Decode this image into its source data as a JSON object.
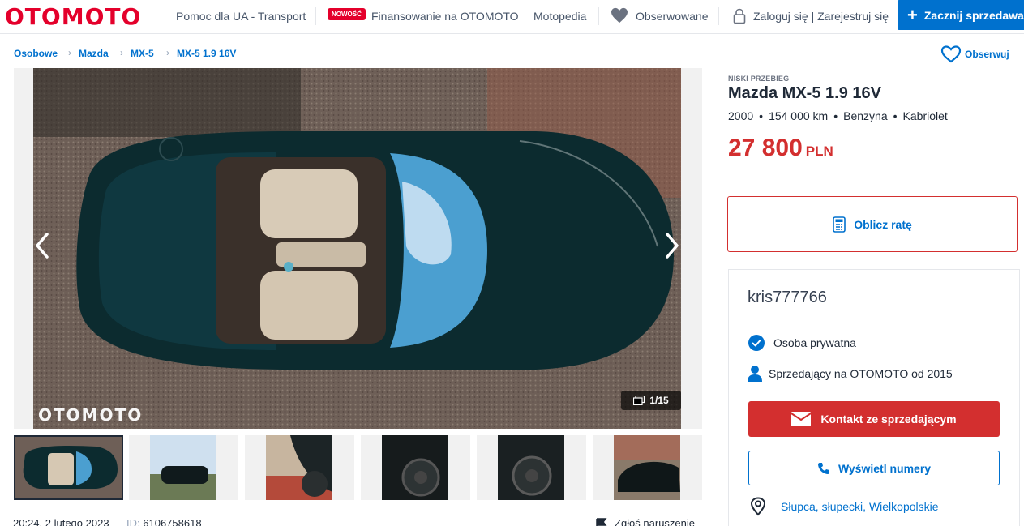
{
  "header": {
    "logo": "OTOMOTO",
    "nav": [
      {
        "label": "Pomoc dla UA - Transport"
      },
      {
        "label": "Finansowanie na OTOMOTO",
        "badge": "NOWOŚĆ"
      },
      {
        "label": "Motopedia"
      },
      {
        "label": "Obserwowane",
        "icon": "heart-icon"
      },
      {
        "label": "Zaloguj się | Zarejestruj się",
        "icon": "lock-icon"
      }
    ],
    "sell_button": "Zacznij sprzedawać"
  },
  "breadcrumb": [
    "Osobowe",
    "Mazda",
    "MX-5",
    "MX-5 1.9 16V"
  ],
  "watch_label": "Obserwuj",
  "gallery": {
    "counter": "1/15",
    "watermark": "OTOMOTO",
    "thumbnails": 6
  },
  "listing": {
    "tag": "NISKI PRZEBIEG",
    "title": "Mazda MX-5 1.9 16V",
    "specs": [
      "2000",
      "154 000 km",
      "Benzyna",
      "Kabriolet"
    ],
    "price": "27 800",
    "currency": "PLN",
    "date": "20:24, 2 lutego 2023",
    "id_label": "ID:",
    "id": "6106758618",
    "report_label": "Zgłoś naruszenie"
  },
  "calc_label": "Oblicz ratę",
  "seller": {
    "name": "kris777766",
    "type": "Osoba prywatna",
    "since": "Sprzedający na OTOMOTO od 2015",
    "contact_label": "Kontakt ze sprzedającym",
    "phone_label": "Wyświetl numery",
    "location": "Słupca, słupecki, Wielkopolskie"
  },
  "colors": {
    "brand": "#e4002b",
    "accent": "#0071ce",
    "price": "#d32f2f"
  }
}
